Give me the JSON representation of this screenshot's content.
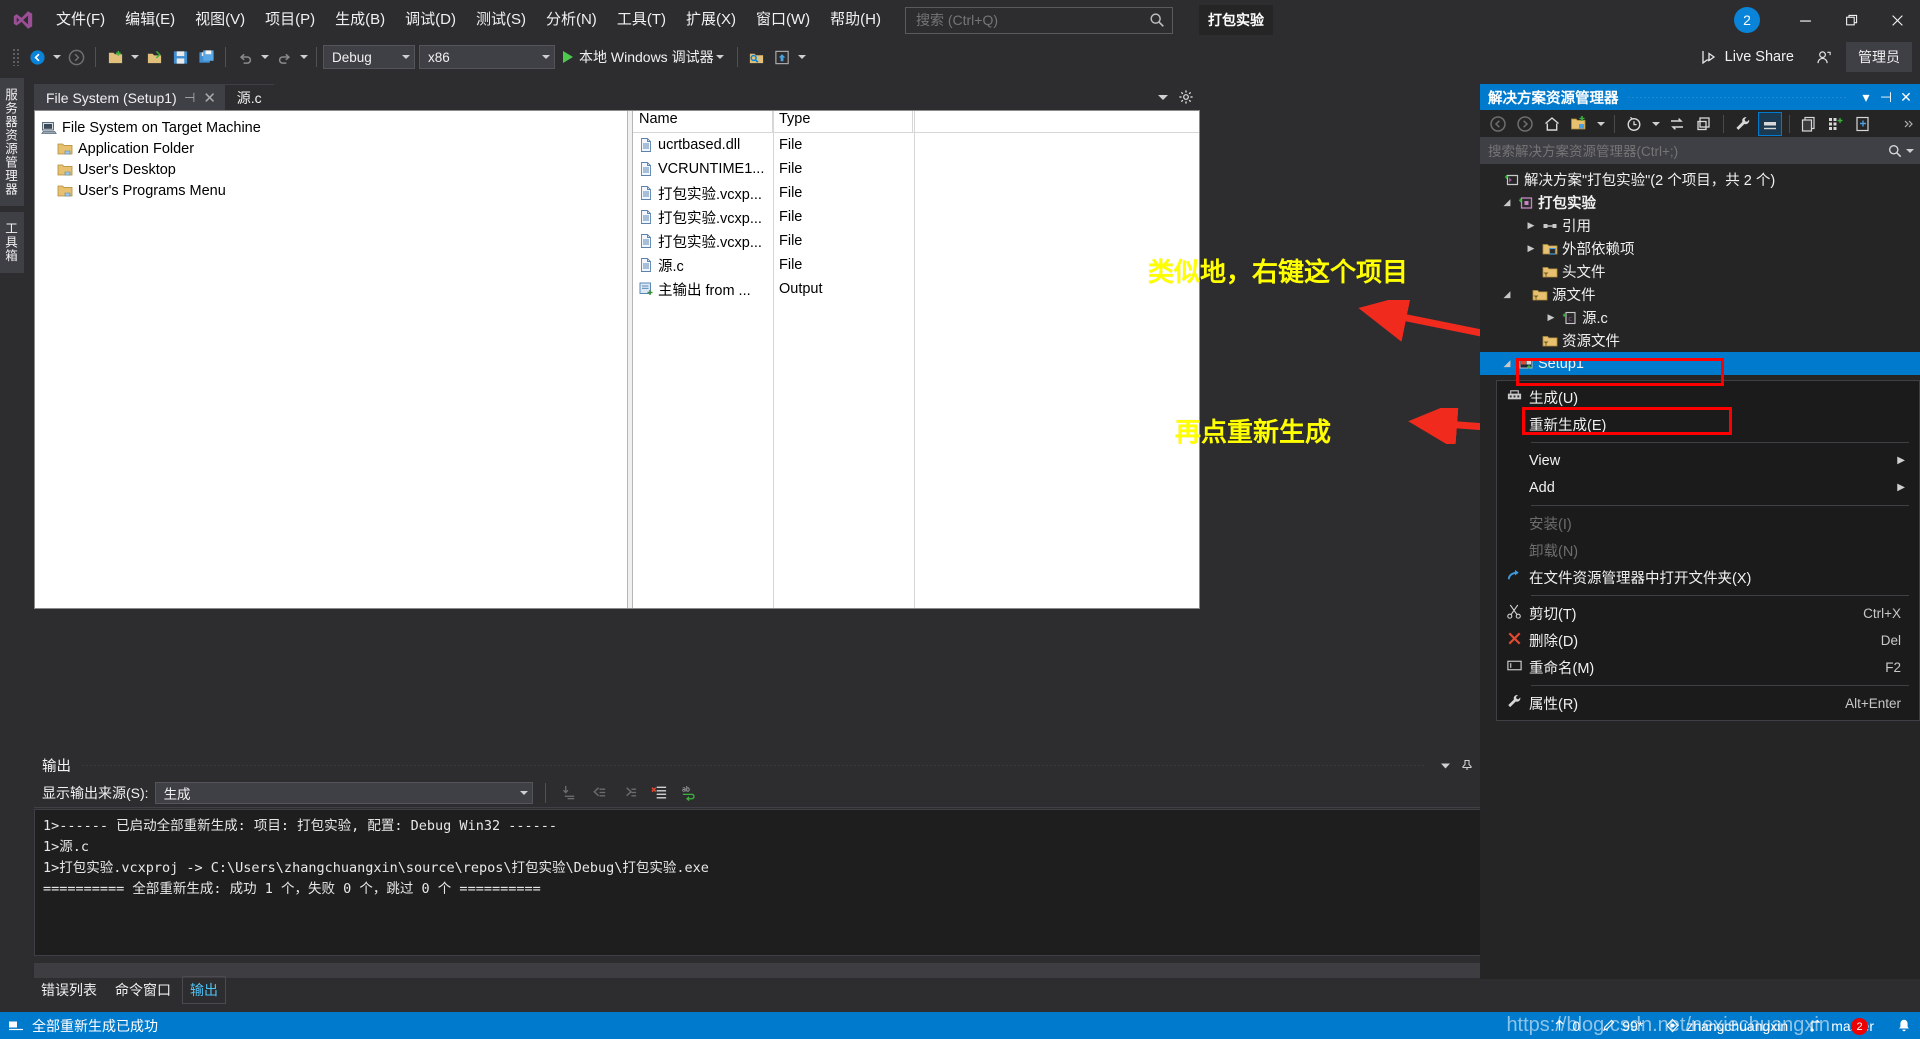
{
  "app": {
    "menus": [
      "文件(F)",
      "编辑(E)",
      "视图(V)",
      "项目(P)",
      "生成(B)",
      "调试(D)",
      "测试(S)",
      "分析(N)",
      "工具(T)",
      "扩展(X)",
      "窗口(W)",
      "帮助(H)"
    ],
    "search_placeholder": "搜索 (Ctrl+Q)",
    "solution_chip": "打包实验",
    "notification_count": "2",
    "live_share": "Live Share",
    "admin_label": "管理员",
    "accent_color": "#007acc"
  },
  "toolbar": {
    "configuration": "Debug",
    "platform": "x86",
    "run_label": "本地 Windows 调试器"
  },
  "left_vtabs": [
    "服务器资源管理器",
    "工具箱"
  ],
  "document": {
    "tabs": [
      {
        "label": "File System (Setup1)",
        "active": true
      },
      {
        "label": "源.c",
        "active": false
      }
    ],
    "tree": [
      {
        "label": "File System on Target Machine",
        "level": 0,
        "icon": "computer-icon"
      },
      {
        "label": "Application Folder",
        "level": 1,
        "icon": "folder-icon"
      },
      {
        "label": "User's Desktop",
        "level": 1,
        "icon": "folder-icon"
      },
      {
        "label": "User's Programs Menu",
        "level": 1,
        "icon": "folder-icon"
      }
    ],
    "file_list": {
      "columns": [
        "Name",
        "Type"
      ],
      "rows": [
        {
          "name": "ucrtbased.dll",
          "type": "File",
          "icon": "file-icon"
        },
        {
          "name": "VCRUNTIME1...",
          "type": "File",
          "icon": "file-icon"
        },
        {
          "name": "打包实验.vcxp...",
          "type": "File",
          "icon": "file-icon"
        },
        {
          "name": "打包实验.vcxp...",
          "type": "File",
          "icon": "file-icon"
        },
        {
          "name": "打包实验.vcxp...",
          "type": "File",
          "icon": "file-icon"
        },
        {
          "name": "源.c",
          "type": "File",
          "icon": "file-icon"
        },
        {
          "name": "主输出 from ...",
          "type": "Output",
          "icon": "output-icon"
        }
      ]
    }
  },
  "annotations": [
    {
      "text": "类似地，右键这个项目",
      "color": "#ffff00"
    },
    {
      "text": "再点重新生成",
      "color": "#ffff00"
    }
  ],
  "output_panel": {
    "title": "输出",
    "source_label": "显示输出来源(S):",
    "source_value": "生成",
    "lines": [
      "1>------ 已启动全部重新生成: 项目: 打包实验, 配置: Debug Win32 ------",
      "1>源.c",
      "1>打包实验.vcxproj -> C:\\Users\\zhangchuangxin\\source\\repos\\打包实验\\Debug\\打包实验.exe",
      "========== 全部重新生成: 成功 1 个，失败 0 个，跳过 0 个 =========="
    ]
  },
  "bottom_tabs": [
    {
      "label": "错误列表",
      "active": false
    },
    {
      "label": "命令窗口",
      "active": false
    },
    {
      "label": "输出",
      "active": true
    }
  ],
  "solution_explorer": {
    "title": "解决方案资源管理器",
    "search_placeholder": "搜索解决方案资源管理器(Ctrl+;)",
    "tree": [
      {
        "label": "解决方案\"打包实验\"(2 个项目，共 2 个)",
        "indent": 0,
        "expander": "",
        "icon": "solution-icon",
        "bold": false,
        "selected": false
      },
      {
        "label": "打包实验",
        "indent": 1,
        "expander": "▲",
        "icon": "project-icon",
        "bold": true,
        "selected": false
      },
      {
        "label": "引用",
        "indent": 2,
        "expander": "▶",
        "icon": "references-icon",
        "bold": false,
        "selected": false
      },
      {
        "label": "外部依赖项",
        "indent": 2,
        "expander": "▶",
        "icon": "folder-ext-icon",
        "bold": false,
        "selected": false
      },
      {
        "label": "头文件",
        "indent": 2,
        "expander": "",
        "icon": "folder-filter-icon",
        "bold": false,
        "selected": false
      },
      {
        "label": "源文件",
        "indent": 2,
        "expander": "▲",
        "icon": "folder-filter-icon",
        "bold": false,
        "selected": false
      },
      {
        "label": "源.c",
        "indent": 3,
        "expander": "▶",
        "icon": "c-file-icon",
        "bold": false,
        "selected": false
      },
      {
        "label": "资源文件",
        "indent": 2,
        "expander": "",
        "icon": "folder-filter-icon",
        "bold": false,
        "selected": false
      },
      {
        "label": "Setup1",
        "indent": 1,
        "expander": "▲",
        "icon": "setup-project-icon",
        "bold": false,
        "selected": true
      }
    ]
  },
  "context_menu": {
    "items": [
      {
        "label": "生成(U)",
        "shortcut": "",
        "icon": "build-icon",
        "submenu": false,
        "disabled": false,
        "separator_after": false
      },
      {
        "label": "重新生成(E)",
        "shortcut": "",
        "icon": "",
        "submenu": false,
        "disabled": false,
        "separator_after": true
      },
      {
        "label": "View",
        "shortcut": "",
        "icon": "",
        "submenu": true,
        "disabled": false,
        "separator_after": false
      },
      {
        "label": "Add",
        "shortcut": "",
        "icon": "",
        "submenu": true,
        "disabled": false,
        "separator_after": true
      },
      {
        "label": "安装(I)",
        "shortcut": "",
        "icon": "",
        "submenu": false,
        "disabled": true,
        "separator_after": false
      },
      {
        "label": "卸载(N)",
        "shortcut": "",
        "icon": "",
        "submenu": false,
        "disabled": true,
        "separator_after": false
      },
      {
        "label": "在文件资源管理器中打开文件夹(X)",
        "shortcut": "",
        "icon": "open-folder-icon",
        "submenu": false,
        "disabled": false,
        "separator_after": true
      },
      {
        "label": "剪切(T)",
        "shortcut": "Ctrl+X",
        "icon": "scissors-icon",
        "submenu": false,
        "disabled": false,
        "separator_after": false
      },
      {
        "label": "删除(D)",
        "shortcut": "Del",
        "icon": "delete-x-icon",
        "submenu": false,
        "disabled": false,
        "separator_after": false
      },
      {
        "label": "重命名(M)",
        "shortcut": "F2",
        "icon": "rename-icon",
        "submenu": false,
        "disabled": false,
        "separator_after": true
      },
      {
        "label": "属性(R)",
        "shortcut": "Alt+Enter",
        "icon": "wrench-icon",
        "submenu": false,
        "disabled": false,
        "separator_after": false
      }
    ]
  },
  "status_bar": {
    "message": "全部重新生成已成功",
    "pending_changes": "0",
    "unsaved_edits": "99*",
    "user": "zhangchuangxin",
    "branch": "master",
    "notifications": "2"
  },
  "watermark": "https://blog.csdn.net/nexiechuangxin"
}
